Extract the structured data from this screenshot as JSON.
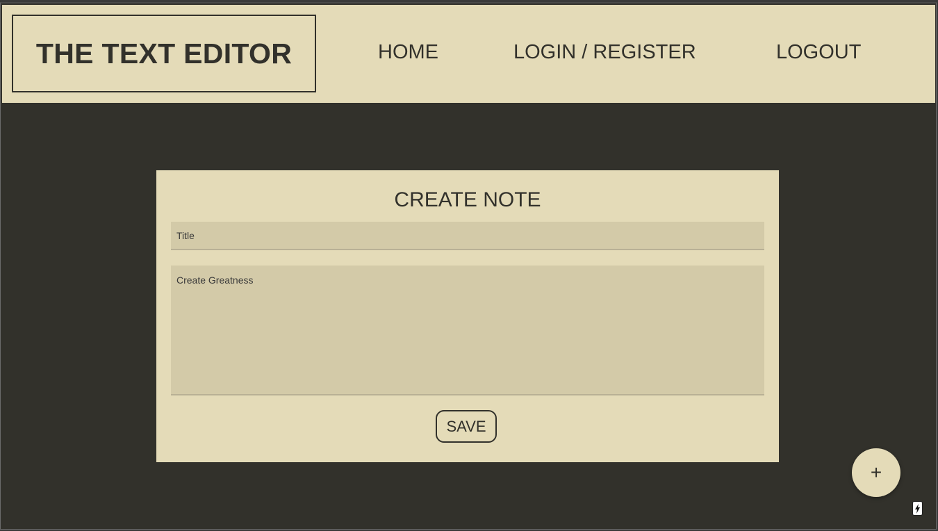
{
  "header": {
    "brand": "THE TEXT EDITOR",
    "nav": {
      "home": "HOME",
      "login_register": "LOGIN / REGISTER",
      "logout": "LOGOUT"
    }
  },
  "note_form": {
    "heading": "CREATE NOTE",
    "title_placeholder": "Title",
    "content_placeholder": "Create Greatness",
    "save_label": "SAVE"
  },
  "fab": {
    "label": "+",
    "icon": "plus-icon"
  },
  "corner_badge": {
    "icon": "lightning-bolt-icon"
  },
  "colors": {
    "background": "#32312b",
    "panel": "#e4dbb8",
    "input": "#d3caa8",
    "text": "#32312b"
  }
}
